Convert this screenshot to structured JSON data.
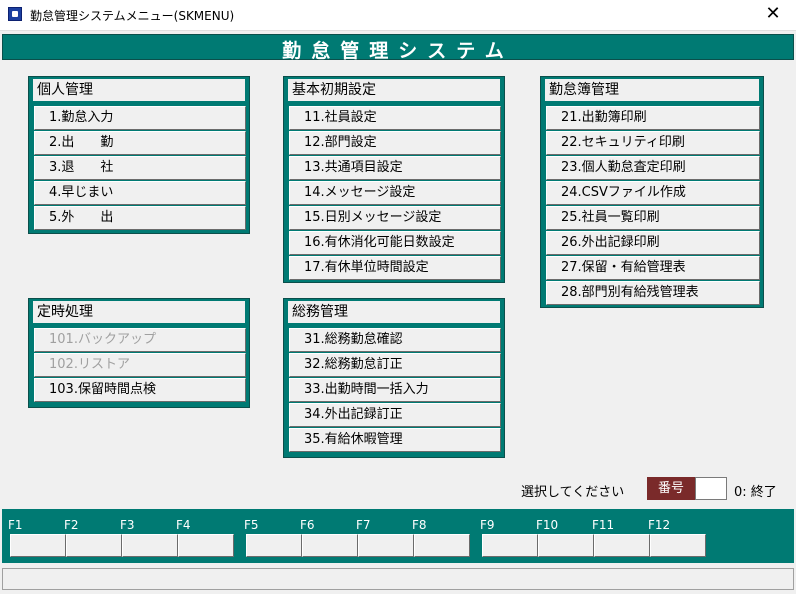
{
  "window": {
    "title": "勤怠管理システムメニュー(SKMENU)",
    "close_glyph": "✕"
  },
  "header": {
    "title": "勤怠管理システム"
  },
  "groups": {
    "personal": {
      "title": "個人管理",
      "items": [
        {
          "label": "1.勤怠入力",
          "enabled": true
        },
        {
          "label": "2.出　　勤",
          "enabled": true
        },
        {
          "label": "3.退　　社",
          "enabled": true
        },
        {
          "label": "4.早じまい",
          "enabled": true
        },
        {
          "label": "5.外　　出",
          "enabled": true
        }
      ]
    },
    "basic": {
      "title": "基本初期設定",
      "items": [
        {
          "label": "11.社員設定",
          "enabled": true
        },
        {
          "label": "12.部門設定",
          "enabled": true
        },
        {
          "label": "13.共通項目設定",
          "enabled": true
        },
        {
          "label": "14.メッセージ設定",
          "enabled": true
        },
        {
          "label": "15.日別メッセージ設定",
          "enabled": true
        },
        {
          "label": "16.有休消化可能日数設定",
          "enabled": true
        },
        {
          "label": "17.有休単位時間設定",
          "enabled": true
        }
      ]
    },
    "ledger": {
      "title": "勤怠簿管理",
      "items": [
        {
          "label": "21.出勤簿印刷",
          "enabled": true
        },
        {
          "label": "22.セキュリティ印刷",
          "enabled": true
        },
        {
          "label": "23.個人勤怠査定印刷",
          "enabled": true
        },
        {
          "label": "24.CSVファイル作成",
          "enabled": true
        },
        {
          "label": "25.社員一覧印刷",
          "enabled": true
        },
        {
          "label": "26.外出記録印刷",
          "enabled": true
        },
        {
          "label": "27.保留・有給管理表",
          "enabled": true
        },
        {
          "label": "28.部門別有給残管理表",
          "enabled": true
        }
      ]
    },
    "scheduled": {
      "title": "定時処理",
      "items": [
        {
          "label": "101.バックアップ",
          "enabled": false
        },
        {
          "label": "102.リストア",
          "enabled": false
        },
        {
          "label": "103.保留時間点検",
          "enabled": true
        }
      ]
    },
    "general": {
      "title": "総務管理",
      "items": [
        {
          "label": "31.総務勤怠確認",
          "enabled": true
        },
        {
          "label": "32.総務勤怠訂正",
          "enabled": true
        },
        {
          "label": "33.出勤時間一括入力",
          "enabled": true
        },
        {
          "label": "34.外出記録訂正",
          "enabled": true
        },
        {
          "label": "35.有給休暇管理",
          "enabled": true
        }
      ]
    }
  },
  "selection": {
    "prompt": "選択してください",
    "number_label": "番号",
    "number_value": "",
    "quit_hint": "0: 終了"
  },
  "function_keys": [
    "F1",
    "F2",
    "F3",
    "F4",
    "F5",
    "F6",
    "F7",
    "F8",
    "F9",
    "F10",
    "F11",
    "F12"
  ],
  "status": {
    "text": ""
  },
  "colors": {
    "teal": "#007a73",
    "number_label_bg": "#7a2a2a",
    "disabled_text": "#a0a0a0"
  }
}
